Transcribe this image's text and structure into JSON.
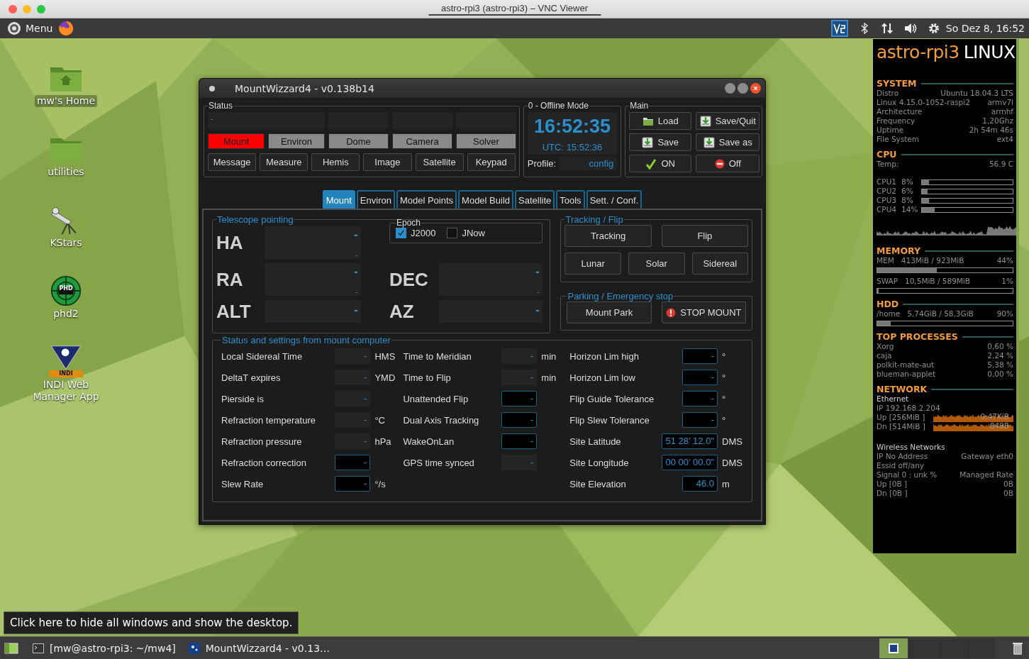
{
  "vnc_window": {
    "title": "astro-rpi3 (astro-rpi3) – VNC Viewer"
  },
  "top_panel": {
    "menu_label": "Menu",
    "clock": "So Dez 8, 16:52"
  },
  "desktop_icons": [
    {
      "label": "mw's Home",
      "kind": "home",
      "selected": true
    },
    {
      "label": "utilities",
      "kind": "folder",
      "selected": false
    },
    {
      "label": "KStars",
      "kind": "telescope",
      "selected": false
    },
    {
      "label": "phd2",
      "kind": "phd",
      "badge": "PHD",
      "selected": false
    },
    {
      "label": "INDI Web Manager App",
      "kind": "indi",
      "badge": "INDI",
      "selected": false
    }
  ],
  "mountwizzard": {
    "title": "MountWizzard4 - v0.138b14",
    "status": {
      "title": "Status",
      "message": "-",
      "devices": [
        {
          "label": "Mount",
          "error": true
        },
        {
          "label": "Environ",
          "error": false
        },
        {
          "label": "Dome",
          "error": false
        },
        {
          "label": "Camera",
          "error": false
        },
        {
          "label": "Solver",
          "error": false
        }
      ],
      "buttons": [
        "Message",
        "Measure",
        "Hemis",
        "Image",
        "Satellite",
        "Keypad"
      ]
    },
    "mode": {
      "title": "0 - Offline Mode",
      "time": "16:52:35",
      "utc": "UTC: 15:52:36",
      "profile_label": "Profile:",
      "profile": "config"
    },
    "main": {
      "title": "Main",
      "buttons": [
        "Load",
        "Save/Quit",
        "Save",
        "Save as",
        "ON",
        "Off"
      ]
    },
    "tabs": [
      {
        "label": "Mount",
        "selected": true
      },
      {
        "label": "Environ",
        "selected": false
      },
      {
        "label": "Model Points",
        "selected": false
      },
      {
        "label": "Model Build",
        "selected": false
      },
      {
        "label": "Satellite",
        "selected": false
      },
      {
        "label": "Tools",
        "selected": false
      },
      {
        "label": "Sett. / Conf.",
        "selected": false
      }
    ],
    "pointing": {
      "title": "Telescope pointing",
      "epoch": {
        "title": "Epoch",
        "options": [
          {
            "label": "J2000",
            "checked": true
          },
          {
            "label": "JNow",
            "checked": false
          }
        ]
      },
      "rows": [
        [
          {
            "label": "HA",
            "value": "-",
            "sub": "-"
          }
        ],
        [
          {
            "label": "RA",
            "value": "-",
            "sub": "-"
          },
          {
            "label": "DEC",
            "value": "-",
            "sub": "-"
          }
        ],
        [
          {
            "label": "ALT",
            "value": "-"
          },
          {
            "label": "AZ",
            "value": "-"
          }
        ]
      ]
    },
    "tracking": {
      "title": "Tracking / Flip",
      "rows": [
        [
          "Tracking",
          "Flip"
        ],
        [
          "Lunar",
          "Solar",
          "Sidereal"
        ]
      ]
    },
    "parking": {
      "title": "Parking / Emergency stop",
      "buttons": [
        "Mount Park",
        "STOP MOUNT"
      ]
    },
    "settings": {
      "title": "Status and settings from mount computer",
      "columns": [
        [
          {
            "label": "Local Sidereal Time",
            "value": "-",
            "unit": "HMS",
            "kind": "readout"
          },
          {
            "label": "DeltaT expires",
            "value": "-",
            "unit": "YMD",
            "kind": "readout"
          },
          {
            "label": "Pierside is",
            "value": "-",
            "kind": "readout"
          },
          {
            "label": "Refraction temperature",
            "value": "-",
            "unit": "°C",
            "kind": "readout"
          },
          {
            "label": "Refraction pressure",
            "value": "-",
            "unit": "hPa",
            "kind": "readout"
          },
          {
            "label": "Refraction correction",
            "value": "-",
            "kind": "input"
          },
          {
            "label": "Slew Rate",
            "value": "-",
            "unit": "°/s",
            "kind": "input"
          }
        ],
        [
          {
            "label": "Time to Meridian",
            "value": "-",
            "unit": "min",
            "kind": "readout"
          },
          {
            "label": "Time to Flip",
            "value": "-",
            "unit": "min",
            "kind": "readout"
          },
          {
            "label": "Unattended Flip",
            "value": "-",
            "kind": "input"
          },
          {
            "label": "Dual Axis Tracking",
            "value": "-",
            "kind": "input"
          },
          {
            "label": "WakeOnLan",
            "value": "-",
            "kind": "input"
          },
          {
            "label": "GPS time synced",
            "value": "-",
            "kind": "readout"
          }
        ],
        [
          {
            "label": "Horizon Lim high",
            "value": "-",
            "unit": "°",
            "kind": "input"
          },
          {
            "label": "Horizon Lim low",
            "value": "-",
            "unit": "°",
            "kind": "input"
          },
          {
            "label": "Flip Guide Tolerance",
            "value": "-",
            "unit": "°",
            "kind": "input"
          },
          {
            "label": "Flip Slew Tolerance",
            "value": "-",
            "unit": "°",
            "kind": "input"
          },
          {
            "label": "Site Latitude",
            "value": "51 28' 12.0\"",
            "unit": "DMS",
            "kind": "input"
          },
          {
            "label": "Site Longitude",
            "value": "00 00' 00.0\"",
            "unit": "DMS",
            "kind": "input"
          },
          {
            "label": "Site Elevation",
            "value": "46.0",
            "unit": "m",
            "kind": "input"
          }
        ]
      ]
    }
  },
  "conky": {
    "title_host": "astro-rpi3",
    "title_os": "LINUX",
    "system": {
      "title": "SYSTEM",
      "rows": [
        {
          "label": "Distro",
          "value": "Ubuntu 18.04.3 LTS"
        },
        {
          "label": "Linux 4.15.0-1052-raspi2",
          "value": "armv7l"
        },
        {
          "label": "Architecture",
          "value": "armhf"
        },
        {
          "label": "Frequency",
          "value": "1,20Ghz"
        },
        {
          "label": "Uptime",
          "value": "2h 54m 46s"
        },
        {
          "label": "File System",
          "value": "ext4"
        }
      ]
    },
    "cpu": {
      "title": "CPU",
      "temp_label": "Temp:",
      "temp": "56.9 C",
      "cores": [
        {
          "label": "CPU1",
          "value": "8%",
          "level": 0.08
        },
        {
          "label": "CPU2",
          "value": "6%",
          "level": 0.06
        },
        {
          "label": "CPU3",
          "value": "8%",
          "level": 0.08
        },
        {
          "label": "CPU4",
          "value": "14%",
          "level": 0.14
        }
      ]
    },
    "memory": {
      "title": "MEMORY",
      "rows": [
        {
          "label": "MEM",
          "usage": "413MiB / 923MiB",
          "percent": "44%",
          "level": 0.44
        },
        {
          "label": "SWAP",
          "usage": "10,5MiB / 589MiB",
          "percent": "1%",
          "level": 0.01
        }
      ]
    },
    "hdd": {
      "title": "HDD",
      "rows": [
        {
          "label": "/home",
          "usage": "5,74GiB / 58,3GiB",
          "percent": "90%",
          "level": 0.1
        }
      ]
    },
    "processes": {
      "title": "TOP PROCESSES",
      "rows": [
        {
          "label": "Xorg",
          "value": "0,60 %"
        },
        {
          "label": "caja",
          "value": "2,24 %"
        },
        {
          "label": "polkit-mate-aut",
          "value": "5,38 %"
        },
        {
          "label": "blueman-applet",
          "value": "0,00 %"
        }
      ]
    },
    "network": {
      "title": "NETWORK",
      "ethernet": {
        "title": "Ethernet",
        "ip": "IP 192.168.2.204",
        "up": "Up [256MiB ]",
        "up_rate": "9,47KiB",
        "down": "Dn [514MiB ]",
        "down_rate": "849B"
      },
      "wireless": {
        "title": "Wireless Networks",
        "rows": [
          {
            "label": "IP No Address",
            "value": "Gateway eth0"
          },
          {
            "label": "Essid off/any"
          },
          {
            "label": "Signal 0 : unk %",
            "value": "Managed Rate"
          },
          {
            "label": "Up [0B ]",
            "value": "0B"
          },
          {
            "label": "Dn [0B ]",
            "value": "0B"
          }
        ]
      }
    }
  },
  "tooltip": "Click here to hide all windows and show the desktop.",
  "taskbar": {
    "items": [
      "[mw@astro-rpi3: ~/mw4]",
      "MountWizzard4 - v0.13…"
    ]
  }
}
